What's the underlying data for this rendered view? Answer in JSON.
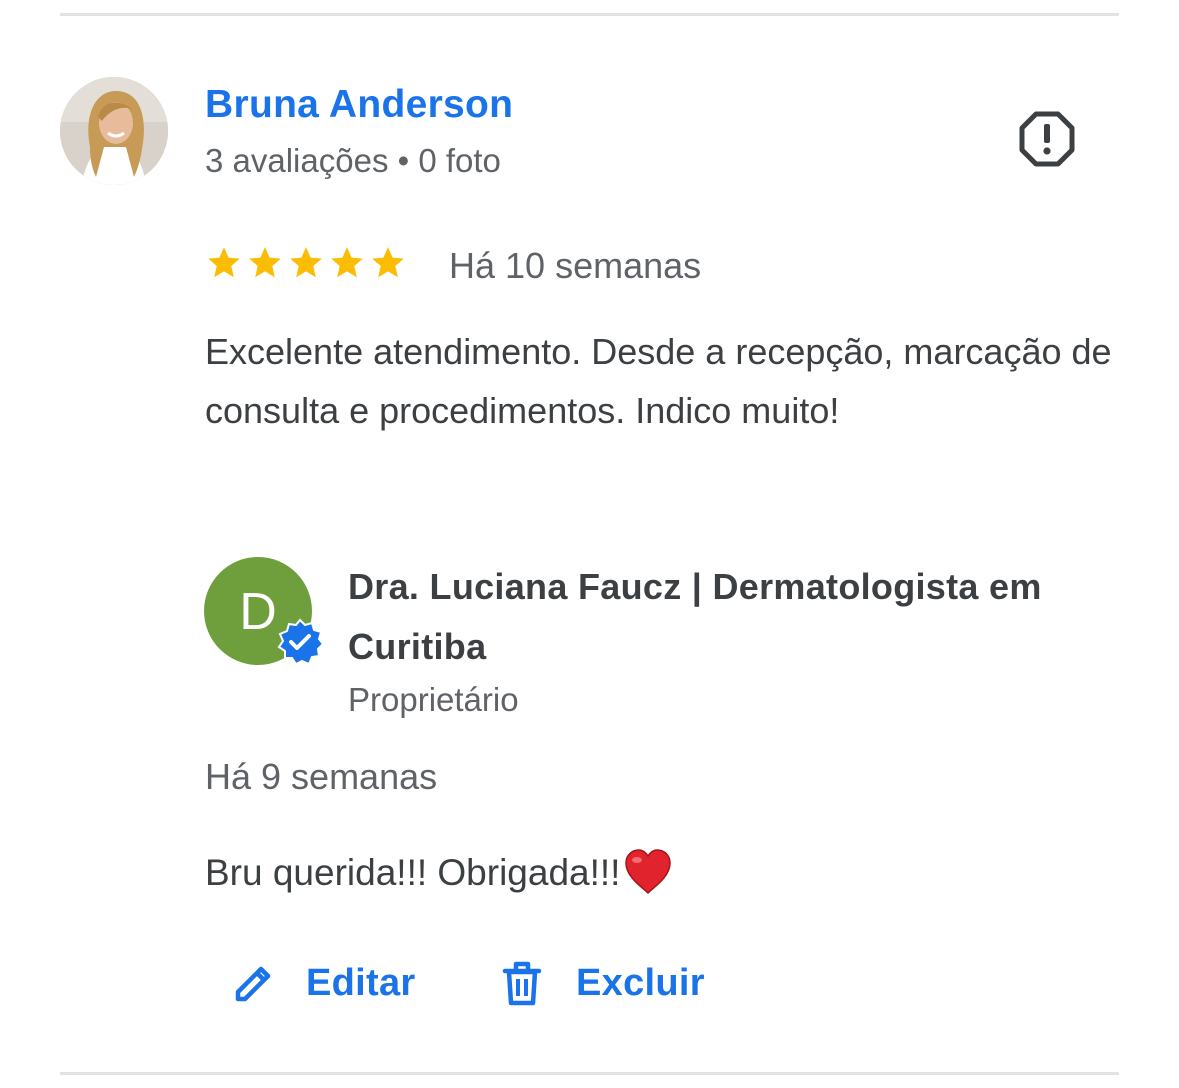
{
  "review": {
    "reviewer_name": "Bruna Anderson",
    "reviewer_meta": "3 avaliações • 0 foto",
    "rating": 5,
    "max_rating": 5,
    "time": "Há 10 semanas",
    "text": "Excelente atendimento. Desde a recepção, marcação de consulta e procedimentos. Indico muito!"
  },
  "owner_reply": {
    "avatar_letter": "D",
    "name": "Dra. Luciana Faucz | Dermatologista em Curitiba",
    "role": "Proprietário",
    "time": "Há 9 semanas",
    "text": "Bru querida!!! Obrigada!!!"
  },
  "actions": {
    "edit_label": "Editar",
    "delete_label": "Excluir"
  },
  "colors": {
    "accent": "#1a73e8",
    "star": "#fbbc04",
    "owner_avatar": "#6f9e3d",
    "muted_text": "#5f6368",
    "body_text": "#3c4043"
  },
  "icons": [
    "report-icon",
    "star-icon",
    "verified-badge-icon",
    "heart-emoji-icon",
    "pencil-icon",
    "trash-icon"
  ]
}
